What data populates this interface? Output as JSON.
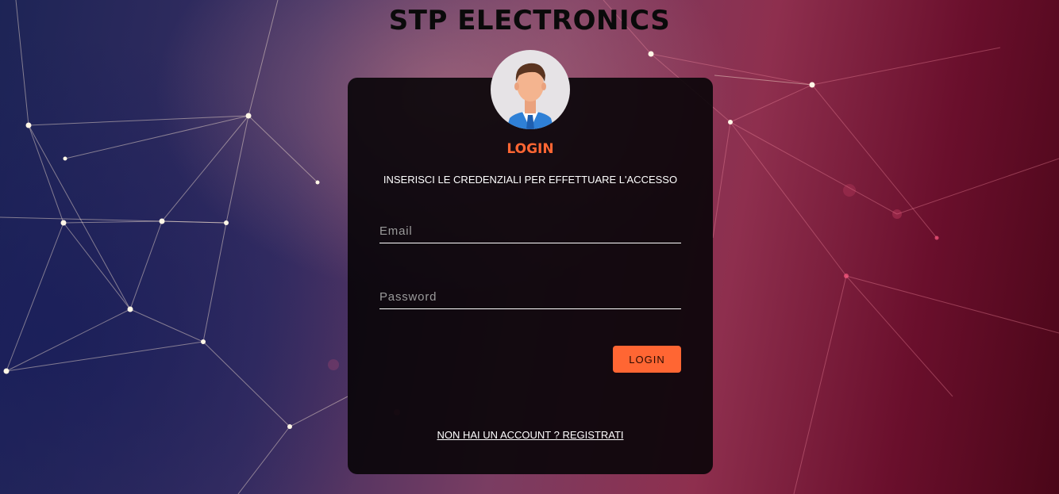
{
  "brand": {
    "title": "STP ELECTRONICS"
  },
  "login_card": {
    "avatar_icon": "user-avatar-icon",
    "title": "LOGIN",
    "subtitle": "INSERISCI LE CREDENZIALI PER EFFETTUARE L'ACCESSO",
    "email": {
      "placeholder": "Email",
      "value": ""
    },
    "password": {
      "placeholder": "Password",
      "value": ""
    },
    "login_button_label": "LOGIN",
    "register_link_label": "NON HAI UN ACCOUNT ? REGISTRATI"
  },
  "colors": {
    "accent": "#ff6633",
    "card_background": "#080408",
    "text": "#ffffff"
  }
}
